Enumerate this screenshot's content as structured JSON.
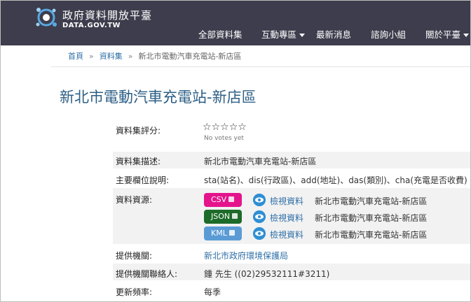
{
  "header": {
    "site_name": "政府資料開放平臺",
    "site_domain": "DATA.GOV.TW",
    "nav": [
      {
        "label": "全部資料集"
      },
      {
        "label": "互動專區"
      },
      {
        "label": "最新消息"
      },
      {
        "label": "諮詢小組"
      },
      {
        "label": "關於平臺"
      }
    ]
  },
  "breadcrumb": {
    "home": "首頁",
    "datasets": "資料集",
    "current": "新北市電動汽車充電站-新店區",
    "separator": "»"
  },
  "page_title": "新北市電動汽車充電站-新店區",
  "rating": {
    "label": "資料集評分:",
    "stars": [
      "☆",
      "☆",
      "☆",
      "☆",
      "☆"
    ],
    "votes_text": "No votes yet"
  },
  "fields": {
    "description": {
      "label": "資料集描述:",
      "value": "新北市電動汽車充電站-新店區"
    },
    "main_fields": {
      "label": "主要欄位說明:",
      "value": "sta(站名)、dis(行政區)、add(地址)、das(類別)、cha(充電是否收費)"
    },
    "resources_label": "資料資源:",
    "provider": {
      "label": "提供機關:",
      "value": "新北市政府環境保護局"
    },
    "contact": {
      "label": "提供機關聯絡人:",
      "value": "鍾 先生 ((02)29532111#3211)"
    },
    "frequency": {
      "label": "更新頻率:",
      "value": "每季"
    }
  },
  "resources": [
    {
      "format": "CSV",
      "color": "#e4148c",
      "view_label": "檢視資料",
      "name": "新北市電動汽車充電站-新店區"
    },
    {
      "format": "JSON",
      "color": "#1d6b2a",
      "view_label": "檢視資料",
      "name": "新北市電動汽車充電站-新店區"
    },
    {
      "format": "KML",
      "color": "#5b9bd5",
      "view_label": "檢視資料",
      "name": "新北市電動汽車充電站-新店區"
    }
  ],
  "colors": {
    "header_bg": "#3d3d4d",
    "link": "#2f6fa7",
    "title": "#2d5f85",
    "eye": "#2e8fd4"
  }
}
